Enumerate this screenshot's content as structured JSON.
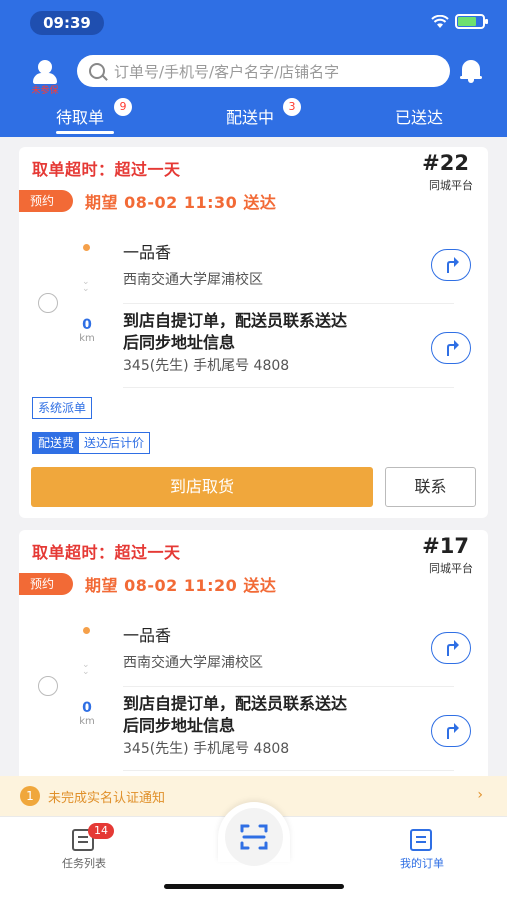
{
  "status_bar": {
    "time": "09:39"
  },
  "header": {
    "avatar_label": "未参保",
    "search_placeholder": "订单号/手机号/客户名字/店铺名字",
    "tabs": [
      {
        "label": "待取单",
        "badge": "9"
      },
      {
        "label": "配送中",
        "badge": "3"
      },
      {
        "label": "已送达",
        "badge": ""
      }
    ]
  },
  "orders": [
    {
      "timeout": "取单超时：超过一天",
      "order_no": "#22",
      "platform": "同城平台",
      "reservation_tag": "预约",
      "expected": "期望 08-02 11:30 送达",
      "store_name": "一品香",
      "store_address": "西南交通大学犀浦校区",
      "distance_value": "0",
      "distance_unit": "km",
      "customer_line1": "到店自提订单，配送员联系送达",
      "customer_line2": "后同步地址信息",
      "customer_contact": "345(先生)   手机尾号 4808",
      "dispatch_tag": "系统派单",
      "fee_label": "配送费",
      "fee_value": "送达后计价",
      "primary_action": "到店取货",
      "secondary_action": "联系"
    },
    {
      "timeout": "取单超时：超过一天",
      "order_no": "#17",
      "platform": "同城平台",
      "reservation_tag": "预约",
      "expected": "期望 08-02 11:20 送达",
      "store_name": "一品香",
      "store_address": "西南交通大学犀浦校区",
      "distance_value": "0",
      "distance_unit": "km",
      "customer_line1": "到店自提订单，配送员联系送达",
      "customer_line2": "后同步地址信息",
      "customer_contact": "345(先生)   手机尾号 4808"
    }
  ],
  "notice": {
    "number": "1",
    "text": "未完成实名认证通知"
  },
  "bottom_nav": {
    "tasks_label": "任务列表",
    "tasks_badge": "14",
    "orders_label": "我的订单"
  },
  "colors": {
    "primary": "#2f6fe4",
    "warning": "#e53935",
    "orange": "#f26a36",
    "gold": "#f0a73c"
  }
}
